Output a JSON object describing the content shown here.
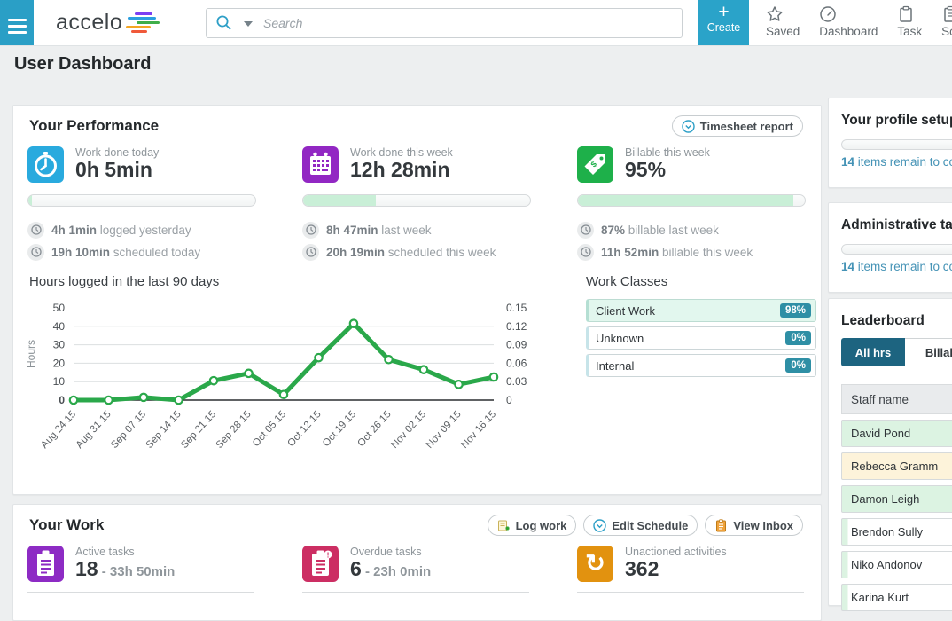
{
  "topbar": {
    "brand": "accelo",
    "search_placeholder": "Search",
    "create_label": "Create",
    "nav_items": [
      {
        "label": "Saved"
      },
      {
        "label": "Dashboard"
      },
      {
        "label": "Task"
      },
      {
        "label": "Schedule"
      }
    ]
  },
  "page_title": "User Dashboard",
  "colors": {
    "topbar_teal": "#2aa3c9",
    "chart_line": "#2aa84a",
    "badge_teal": "#2e8fa5",
    "tab_active": "#1d6480",
    "progress_fill": "#c9efd7"
  },
  "performance": {
    "title": "Your Performance",
    "report_button": "Timesheet report",
    "metrics": [
      {
        "label": "Work done today",
        "value": "0h 5min",
        "icon": "stopwatch-icon",
        "icon_color": "#29aade",
        "progress": 1.5,
        "notes": [
          {
            "bold": "4h 1min",
            "rest": " logged yesterday"
          },
          {
            "bold": "19h 10min",
            "rest": " scheduled today"
          }
        ]
      },
      {
        "label": "Work done this week",
        "value": "12h 28min",
        "icon": "calendar-icon",
        "icon_color": "#9227c3",
        "progress": 32,
        "notes": [
          {
            "bold": "8h 47min",
            "rest": " last week"
          },
          {
            "bold": "20h 19min",
            "rest": " scheduled this week"
          }
        ]
      },
      {
        "label": "Billable this week",
        "value": "95%",
        "icon": "tag-icon",
        "icon_color": "#1eb04a",
        "progress": 95,
        "notes": [
          {
            "bold": "87%",
            "rest": " billable last week"
          },
          {
            "bold": "11h 52min",
            "rest": " billable this week"
          }
        ]
      }
    ],
    "work_classes": {
      "title": "Work Classes",
      "badge_color": "#2e8fa5",
      "rows": [
        {
          "label": "Client Work",
          "value": "98%",
          "highlight": true
        },
        {
          "label": "Unknown",
          "value": "0%",
          "highlight": false
        },
        {
          "label": "Internal",
          "value": "0%",
          "highlight": false
        }
      ]
    }
  },
  "chart_data": {
    "type": "line",
    "title": "Hours logged in the last 90 days",
    "x": [
      "Aug 24 15",
      "Aug 31 15",
      "Sep 07 15",
      "Sep 14 15",
      "Sep 21 15",
      "Sep 28 15",
      "Oct 05 15",
      "Oct 12 15",
      "Oct 19 15",
      "Oct 26 15",
      "Nov 02 15",
      "Nov 09 15",
      "Nov 16 15"
    ],
    "series": [
      {
        "name": "Hours",
        "values": [
          0,
          0,
          1.5,
          0,
          10.5,
          14.5,
          3,
          23,
          41.5,
          22,
          16.5,
          8.5,
          12.5
        ]
      }
    ],
    "ylabel": "Hours",
    "ylim": [
      0,
      50
    ],
    "left_ticks": [
      0,
      10,
      20,
      30,
      40,
      50
    ],
    "right_ticks": [
      "0",
      "0.03",
      "0.06",
      "0.09",
      "0.12",
      "0.15"
    ],
    "right_ylim": [
      0,
      0.15
    ],
    "line_color": "#2aa84a",
    "grid": true,
    "legend": "none"
  },
  "your_work": {
    "title": "Your Work",
    "buttons": [
      {
        "label": "Log work",
        "icon": "log-work-icon"
      },
      {
        "label": "Edit Schedule",
        "icon": "clock-icon"
      },
      {
        "label": "View Inbox",
        "icon": "inbox-icon"
      }
    ],
    "stats": [
      {
        "label": "Active tasks",
        "value": "18",
        "suffix": " - 33h 50min",
        "color": "#8d2bc4",
        "icon": "clipboard-icon"
      },
      {
        "label": "Overdue tasks",
        "value": "6",
        "suffix": " - 23h 0min",
        "color": "#cc2e63",
        "icon": "clipboard-alert-icon"
      },
      {
        "label": "Unactioned activities",
        "value": "362",
        "suffix": "",
        "color": "#e2920f",
        "icon": "sync-icon"
      }
    ]
  },
  "sidebar": {
    "cards": [
      {
        "title": "Your profile setup",
        "remaining_bold": "14",
        "remaining_rest": " items remain to complete",
        "progress": 0
      },
      {
        "title": "Administrative tasks",
        "remaining_bold": "14",
        "remaining_rest": " items remain to complete",
        "progress": 0
      }
    ],
    "leaderboard": {
      "title": "Leaderboard",
      "tabs": [
        {
          "label": "All hrs",
          "active": true
        },
        {
          "label": "Billable",
          "active": false
        }
      ],
      "column_header": "Staff name",
      "rows": [
        {
          "name": "David Pond",
          "fill": 100,
          "fill_color": "#dcf3e2"
        },
        {
          "name": "Rebecca Gramm",
          "fill": 100,
          "fill_color": "#fdf3da"
        },
        {
          "name": "Damon Leigh",
          "fill": 58,
          "fill_color": "#dcf3e2"
        },
        {
          "name": "Brendon Sully",
          "fill": 3,
          "fill_color": "#dcf3e2"
        },
        {
          "name": "Niko Andonov",
          "fill": 3,
          "fill_color": "#dcf3e2"
        },
        {
          "name": "Karina Kurt",
          "fill": 3,
          "fill_color": "#dcf3e2"
        }
      ]
    }
  }
}
